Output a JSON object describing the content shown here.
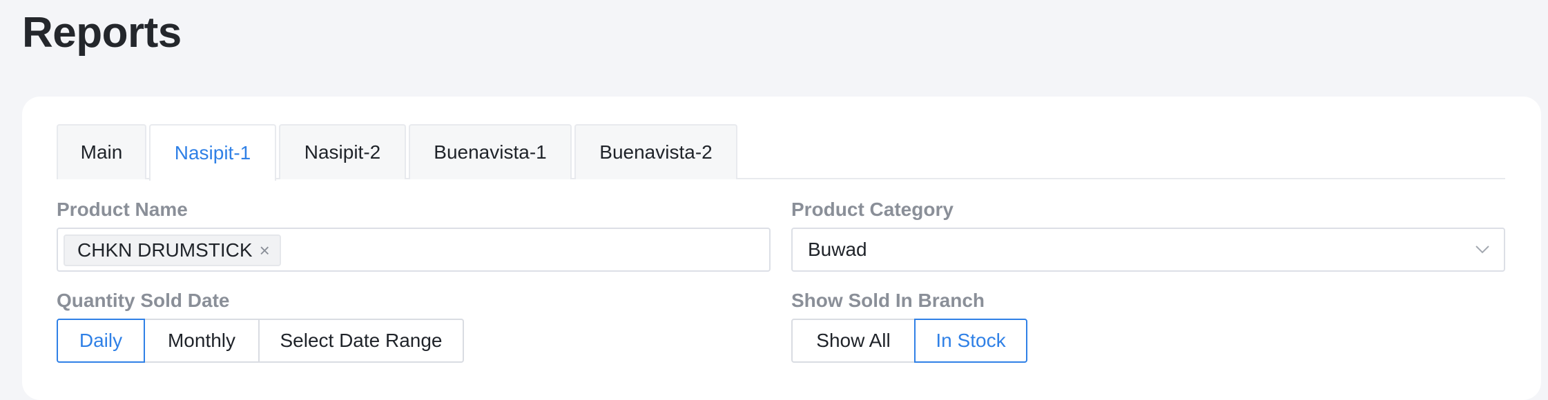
{
  "page": {
    "title": "Reports"
  },
  "tabs": [
    {
      "label": "Main",
      "active": false
    },
    {
      "label": "Nasipit-1",
      "active": true
    },
    {
      "label": "Nasipit-2",
      "active": false
    },
    {
      "label": "Buenavista-1",
      "active": false
    },
    {
      "label": "Buenavista-2",
      "active": false
    }
  ],
  "product_name": {
    "label": "Product Name",
    "tags": [
      "CHKN DRUMSTICK"
    ],
    "tag_close_glyph": "×"
  },
  "product_category": {
    "label": "Product Category",
    "value": "Buwad",
    "icon": "chevron-down-icon"
  },
  "quantity_sold_date": {
    "label": "Quantity Sold Date",
    "options": [
      "Daily",
      "Monthly",
      "Select Date Range"
    ],
    "selected": "Daily"
  },
  "show_sold_in_branch": {
    "label": "Show Sold In Branch",
    "options": [
      "Show All",
      "In Stock"
    ],
    "selected": "In Stock"
  },
  "colors": {
    "accent": "#2f80e6",
    "label_gray": "#8a8f98",
    "background": "#f4f5f8"
  }
}
